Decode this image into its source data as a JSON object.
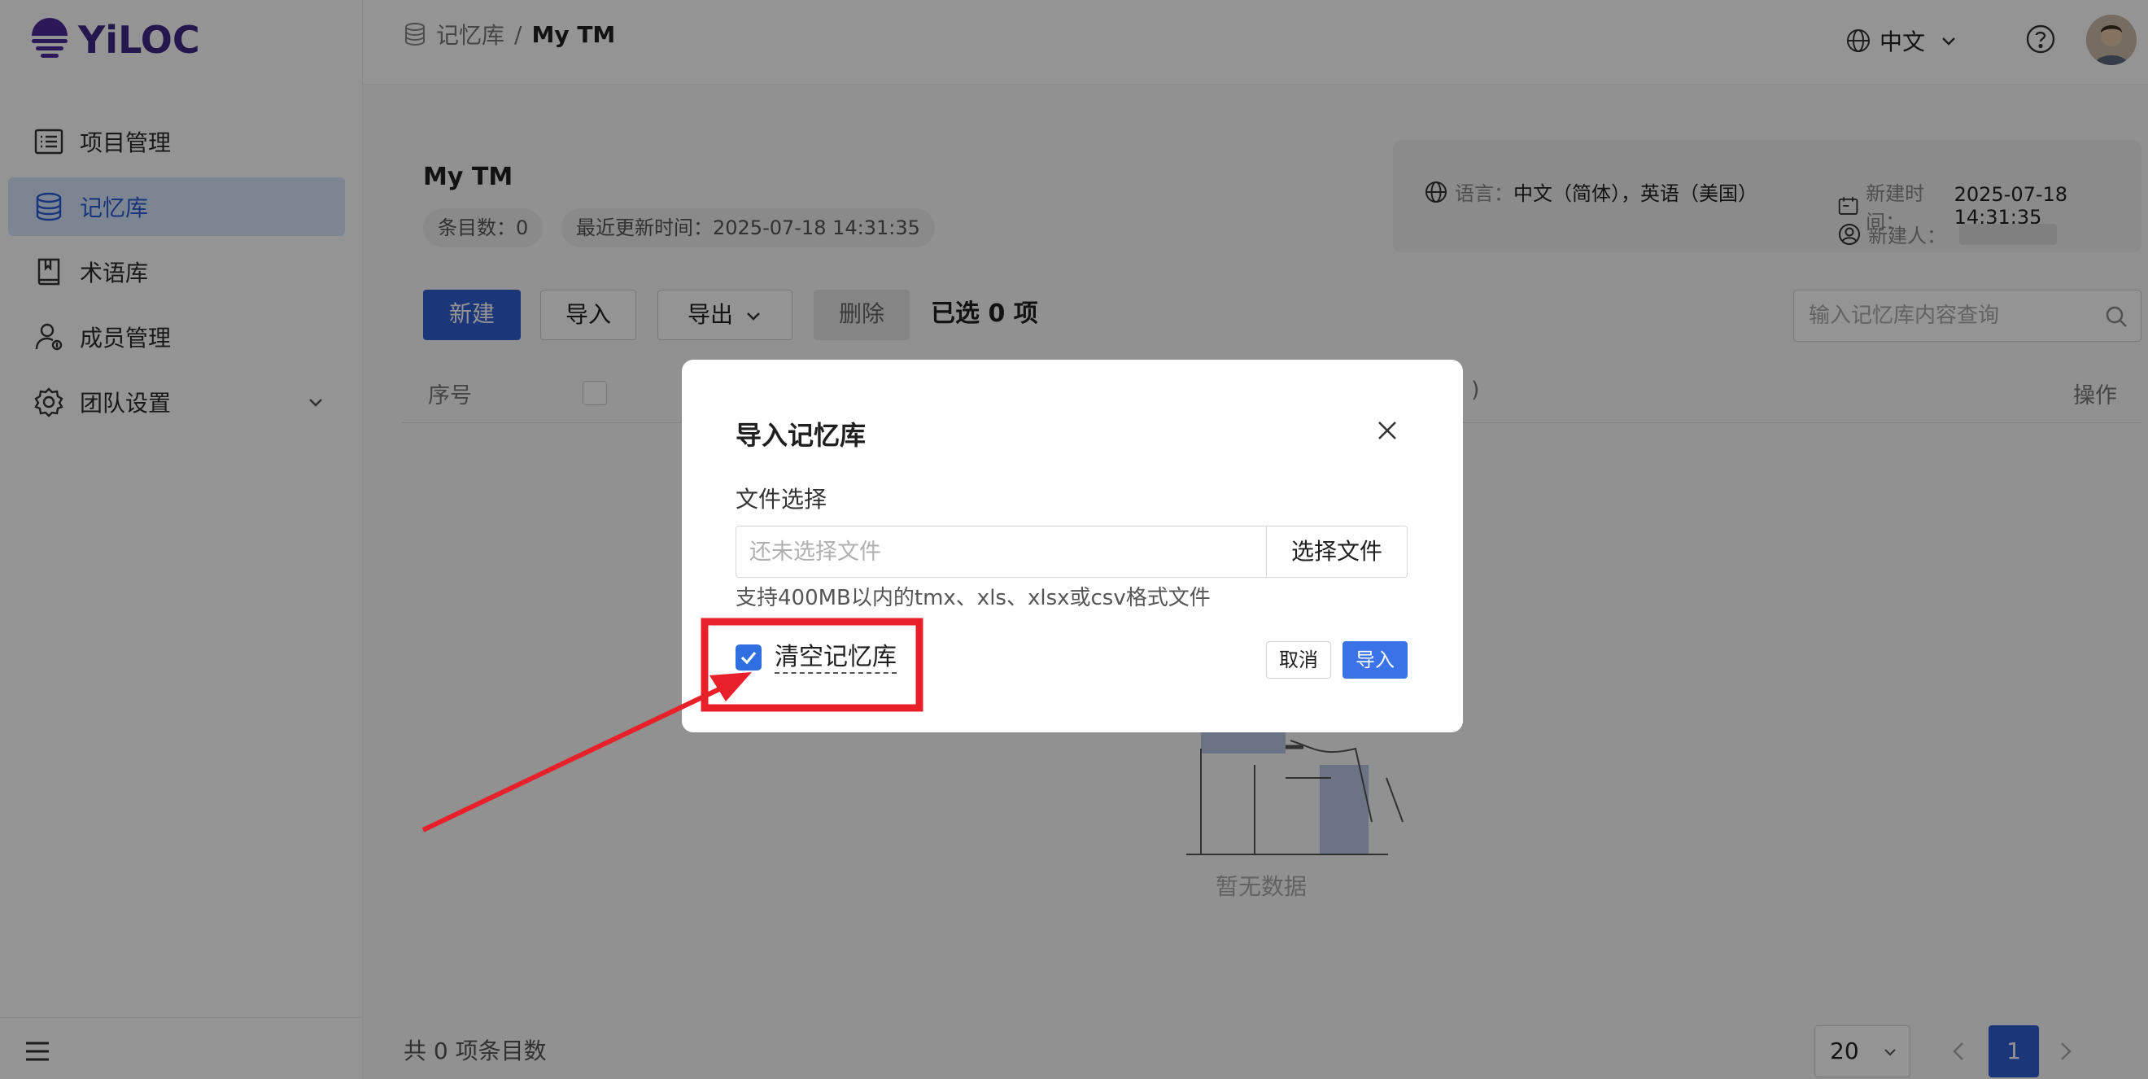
{
  "app": {
    "logo_text": "YiLOC"
  },
  "sidebar": {
    "items": [
      {
        "label": "项目管理",
        "icon": "list-icon"
      },
      {
        "label": "记忆库",
        "icon": "database-icon",
        "active": true
      },
      {
        "label": "术语库",
        "icon": "book-icon"
      },
      {
        "label": "成员管理",
        "icon": "members-icon"
      },
      {
        "label": "团队设置",
        "icon": "gear-icon"
      }
    ],
    "collapse_icon": "menu-icon"
  },
  "header": {
    "breadcrumb_parent": "记忆库",
    "breadcrumb_sep": "/",
    "breadcrumb_current": "My TM",
    "language": "中文"
  },
  "page": {
    "title": "My TM",
    "entry_count": "条目数：0",
    "last_updated": "最近更新时间：2025-07-18 14:31:35",
    "info": {
      "lang_label": "语言：",
      "lang_value": "中文（简体），英语（美国）",
      "created_label": "新建时间：",
      "created_value": "2025-07-18 14:31:35",
      "creator_label": "新建人："
    }
  },
  "toolbar": {
    "new_label": "新建",
    "import_label": "导入",
    "export_label": "导出",
    "delete_label": "删除",
    "selected_text": "已选 0 项",
    "search_placeholder": "输入记忆库内容查询"
  },
  "table": {
    "col_seq": "序号",
    "col_partial": ")",
    "col_ops": "操作",
    "empty_text": "暂无数据"
  },
  "pagination": {
    "total_text": "共 0 项条目数",
    "page_size": "20",
    "current_page": "1"
  },
  "modal": {
    "title": "导入记忆库",
    "field_label": "文件选择",
    "file_placeholder": "还未选择文件",
    "choose_file": "选择文件",
    "hint": "支持400MB以内的tmx、xls、xlsx或csv格式文件",
    "clear_label": "清空记忆库",
    "clear_checked": true,
    "cancel_label": "取消",
    "import_label": "导入"
  },
  "colors": {
    "primary": "#2f5fd0",
    "annotation_red": "#e8202a",
    "logo_purple": "#4b2a9a"
  }
}
